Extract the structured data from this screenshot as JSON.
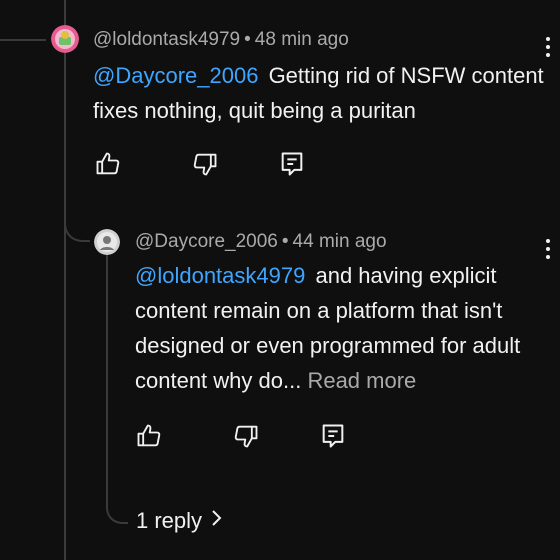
{
  "comment": {
    "username": "@loldontask4979",
    "time": "48 min ago",
    "mention": "@Daycore_2006",
    "text": "Getting rid of NSFW content fixes nothing, quit being a puritan"
  },
  "reply": {
    "username": "@Daycore_2006",
    "time": "44 min ago",
    "mention": "@loldontask4979",
    "text": "and having explicit content remain on a platform that isn't designed or even programmed for adult content why do...",
    "read_more": "Read more"
  },
  "replies_link": {
    "label": "1 reply"
  },
  "separator": "•",
  "icons": {
    "like": "thumb-up-icon",
    "dislike": "thumb-down-icon",
    "reply": "reply-icon",
    "menu": "more-vert-icon",
    "chevron": "chevron-right-icon"
  },
  "colors": {
    "background": "#0f0f0f",
    "mention": "#3ea6ff",
    "meta": "#aaaaaa",
    "text": "#f1f1f1"
  }
}
